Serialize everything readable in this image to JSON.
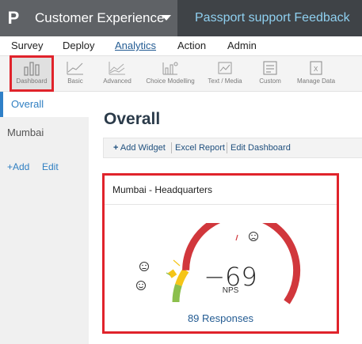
{
  "header": {
    "logo_glyph": "P",
    "app_title": "Customer Experience",
    "project_name": "Passport support Feedback"
  },
  "nav": {
    "items": [
      {
        "label": "Survey"
      },
      {
        "label": "Deploy"
      },
      {
        "label": "Analytics",
        "active": true
      },
      {
        "label": "Action"
      },
      {
        "label": "Admin"
      }
    ]
  },
  "toolbar": {
    "tools": [
      {
        "label": "Dashboard",
        "icon": "dashboard-bars-icon",
        "selected": true
      },
      {
        "label": "Basic",
        "icon": "basic-line-chart-icon"
      },
      {
        "label": "Advanced",
        "icon": "advanced-chart-icon"
      },
      {
        "label": "Choice Modelling",
        "icon": "choice-modelling-icon"
      },
      {
        "label": "Text / Media",
        "icon": "text-media-icon"
      },
      {
        "label": "Custom",
        "icon": "custom-report-icon"
      },
      {
        "label": "Manage Data",
        "icon": "excel-data-icon"
      }
    ]
  },
  "sidebar": {
    "selected": "Overall",
    "items": [
      "Mumbai"
    ],
    "add_label": "+Add",
    "edit_label": "Edit"
  },
  "page": {
    "title": "Overall",
    "actions": {
      "add_widget": "Add Widget",
      "excel_report": "Excel Report",
      "edit_dashboard": "Edit Dashboard"
    }
  },
  "widget": {
    "title": "Mumbai - Headquarters",
    "nps_value": "−69",
    "nps_label": "NPS",
    "responses": "89 Responses",
    "nps_numeric": -69,
    "colors": {
      "promoters": "#8bbf4c",
      "passives": "#f5c518",
      "detractors": "#d1373c",
      "marker": "#f5c518"
    }
  },
  "colors": {
    "header_bg": "#5f6266",
    "project_bg": "#3f4347",
    "project_text": "#8fd0f0",
    "accent": "#2f7fc2",
    "highlight": "#e0232b"
  }
}
